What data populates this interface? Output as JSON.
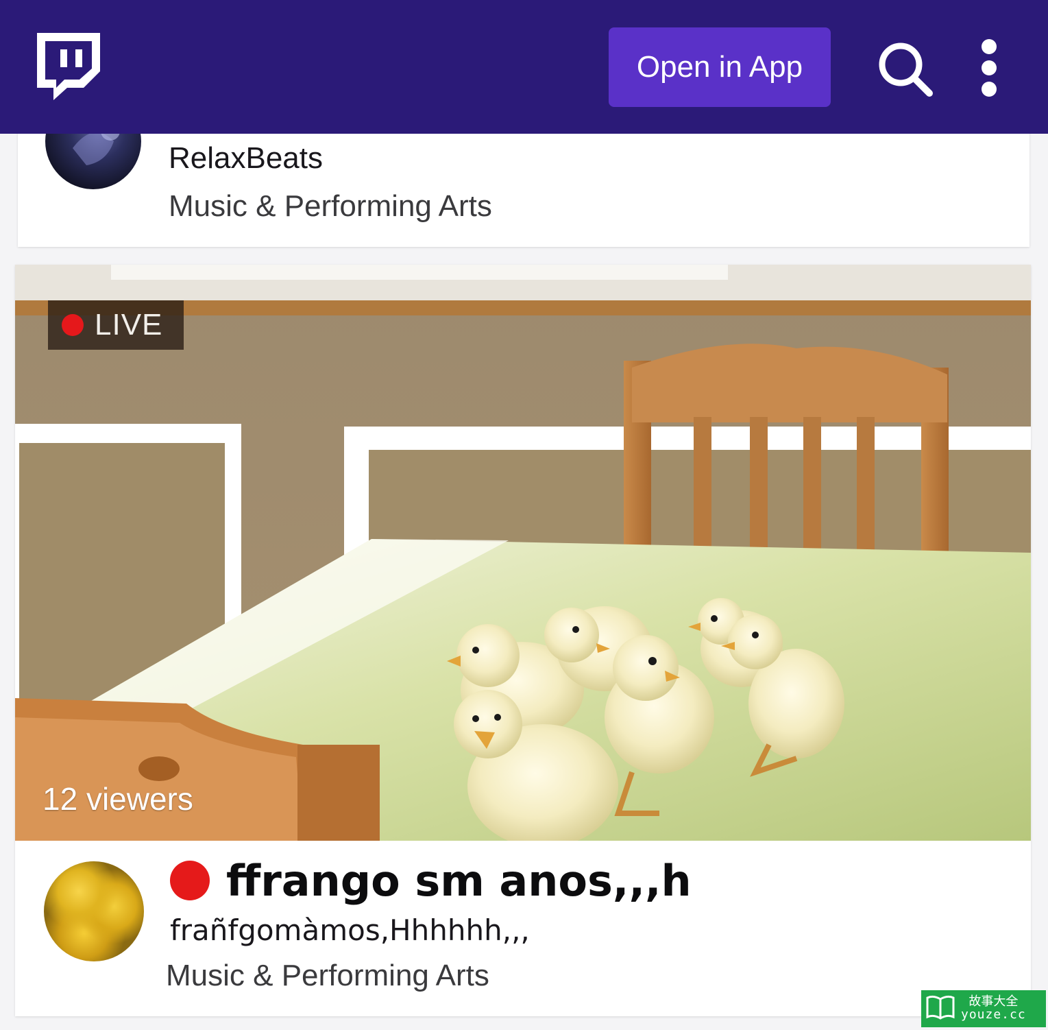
{
  "header": {
    "logo_icon": "twitch-glitch-icon",
    "open_app_label": "Open in App",
    "search_icon": "search-icon",
    "more_icon": "more-vertical-icon",
    "colors": {
      "bar": "#2b1a78",
      "button": "#5a31c8"
    }
  },
  "streams": [
    {
      "channel": "RelaxBeats",
      "category": "Music & Performing Arts"
    },
    {
      "live_label": "LIVE",
      "viewers": "12 viewers",
      "title": "ffrango sm anos,,,h",
      "subtitle": "frañfgomàmos,Hhhhhh,,,",
      "category": "Music & Performing Arts",
      "live_color": "#e51a1a"
    }
  ],
  "watermark": {
    "cn": "故事大全",
    "url": "youze.cc"
  }
}
